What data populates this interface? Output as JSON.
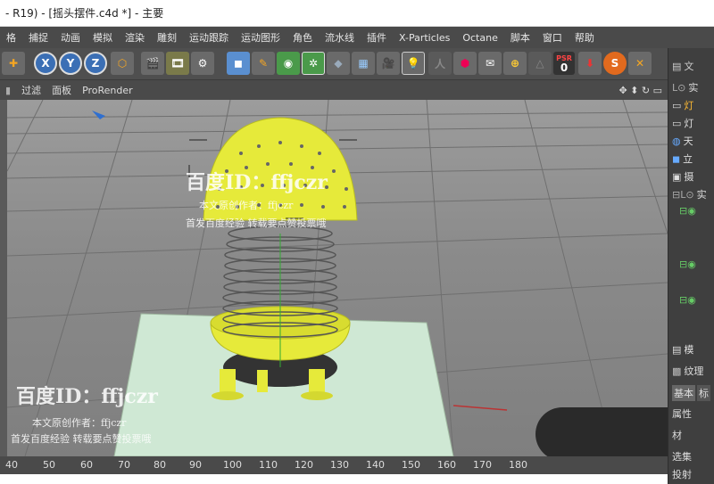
{
  "window": {
    "title": "- R19) - [摇头摆件.c4d *] - 主要"
  },
  "menu": [
    "格",
    "捕捉",
    "动画",
    "模拟",
    "渲染",
    "雕刻",
    "运动跟踪",
    "运动图形",
    "角色",
    "流水线",
    "插件",
    "X-Particles",
    "Octane",
    "脚本",
    "窗口",
    "帮助"
  ],
  "toolbar": {
    "axes": [
      "X",
      "Y",
      "Z"
    ],
    "psr_label": "PSR",
    "psr_value": "0"
  },
  "viewport_menu": [
    "过滤",
    "面板",
    "ProRender"
  ],
  "ruler_ticks": [
    "40",
    "50",
    "60",
    "70",
    "80",
    "90",
    "100",
    "110",
    "120",
    "130",
    "140",
    "150",
    "160",
    "170",
    "180"
  ],
  "right_panel": {
    "tab": "文",
    "items": [
      "实",
      "灯",
      "灯",
      "天",
      "立",
      "摄",
      "实"
    ],
    "mode_label": "模",
    "material_label": "纹理",
    "tabs": [
      "基本",
      "标"
    ],
    "bottom_items": [
      "属性",
      "材",
      "选集",
      "投射"
    ]
  },
  "watermark": {
    "brand": "百度ID：ffjczr",
    "line1": "本文原创作者：ffjczr",
    "line2": "首发百度经验 转载要点赞投票哦"
  },
  "colors": {
    "ui_dark": "#4a4a4a",
    "accent": "#e8e840",
    "object_yellow": "#e6ea3a"
  }
}
